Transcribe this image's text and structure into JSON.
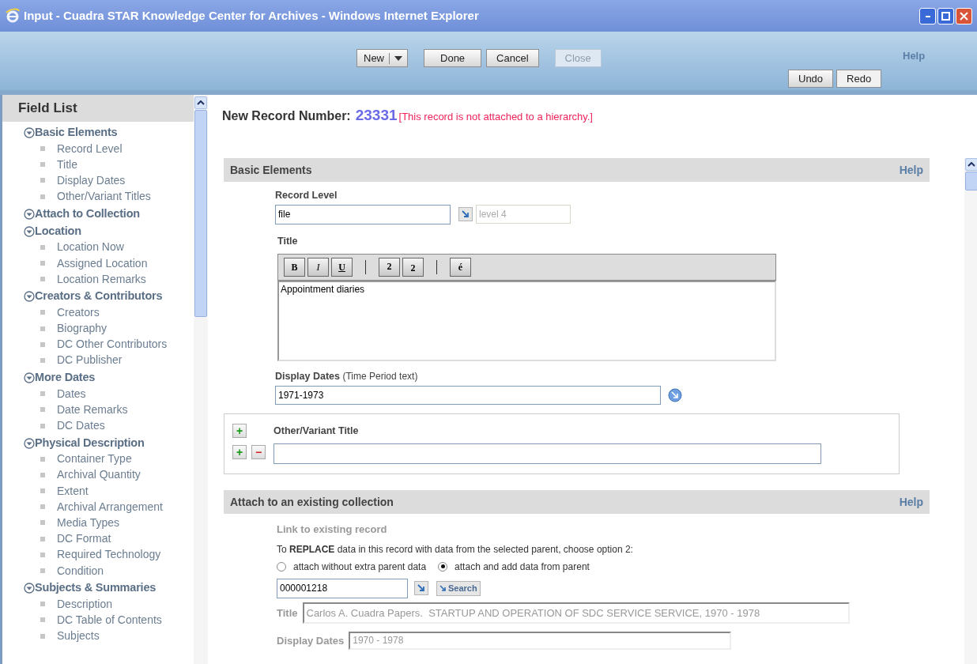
{
  "window": {
    "title": "Input - Cuadra STAR Knowledge Center for Archives - Windows Internet Explorer"
  },
  "toolbar": {
    "buttons": [
      {
        "label": "New",
        "kind": "split",
        "disabled": false
      },
      {
        "label": "Done",
        "kind": "plain",
        "disabled": false
      },
      {
        "label": "Cancel",
        "kind": "plain",
        "disabled": false
      },
      {
        "label": "Close",
        "kind": "plain",
        "disabled": true
      }
    ],
    "help": "Help",
    "history_buttons": [
      {
        "label": "Undo",
        "disabled": false
      },
      {
        "label": "Redo",
        "disabled": false
      }
    ]
  },
  "sidebar": {
    "title": "Field List",
    "groups": [
      {
        "label": "Basic Elements",
        "expanded": true,
        "children": [
          {
            "label": "Record Level"
          },
          {
            "label": "Title"
          },
          {
            "label": "Display Dates"
          },
          {
            "label": "Other/Variant Titles"
          }
        ]
      },
      {
        "label": "Attach to Collection",
        "expanded": true
      },
      {
        "label": "Location",
        "expanded": true,
        "children": [
          {
            "label": "Location Now"
          },
          {
            "label": "Assigned Location"
          },
          {
            "label": "Location Remarks"
          }
        ]
      },
      {
        "label": "Creators & Contributors",
        "expanded": true,
        "children": [
          {
            "label": "Creators"
          },
          {
            "label": "Biography"
          },
          {
            "label": "DC Other Contributors"
          },
          {
            "label": "DC Publisher"
          }
        ]
      },
      {
        "label": "More Dates",
        "expanded": true,
        "children": [
          {
            "label": "Dates"
          },
          {
            "label": "Date Remarks"
          },
          {
            "label": "DC Dates"
          }
        ]
      },
      {
        "label": "Physical Description",
        "expanded": true,
        "children": [
          {
            "label": "Container Type"
          },
          {
            "label": "Archival Quantity"
          },
          {
            "label": "Extent"
          },
          {
            "label": "Archival Arrangement"
          },
          {
            "label": "Media Types"
          },
          {
            "label": "DC Format"
          },
          {
            "label": "Required Technology"
          },
          {
            "label": "Condition"
          }
        ]
      },
      {
        "label": "Subjects & Summaries",
        "expanded": true,
        "children": [
          {
            "label": "Description"
          },
          {
            "label": "DC Table of Contents"
          },
          {
            "label": "Subjects"
          }
        ]
      }
    ]
  },
  "record": {
    "label": "New Record Number:",
    "number": "23331",
    "notice": "[This record is not attached to a hierarchy.]"
  },
  "basic_elements": {
    "title": "Basic Elements",
    "help": "Help",
    "record_level": {
      "label": "Record Level",
      "value": "file",
      "level_value": "level 4"
    },
    "title_field": {
      "label": "Title",
      "format_buttons": [
        {
          "label": "B",
          "kind": "bold"
        },
        {
          "label": "I",
          "kind": "italic"
        },
        {
          "label": "U",
          "kind": "underline"
        },
        {
          "label": "2",
          "kind": "sup"
        },
        {
          "label": "2",
          "kind": "sub"
        },
        {
          "label": "é",
          "kind": "char"
        }
      ],
      "value": "Appointment diaries"
    },
    "display_dates": {
      "label": "Display Dates",
      "hint": "(Time Period text)",
      "value": "1971-1973"
    },
    "other_title": {
      "label": "Other/Variant Title",
      "add": "+",
      "remove": "−"
    }
  },
  "attach": {
    "title": "Attach to an existing collection",
    "help": "Help",
    "link_label": "Link to existing record",
    "instruction": "To **REPLACE** data in this record with data from the selected parent, choose option 2:",
    "options": [
      {
        "label": "attach without extra parent data",
        "selected": false
      },
      {
        "label": "attach and add data from parent",
        "selected": true
      }
    ],
    "record_id": "000001218",
    "search": "Search",
    "parent_title": {
      "label": "Title",
      "value": "Carlos A. Cuadra Papers.  STARTUP AND OPERATION OF SDC SERVICE SERVICE, 1970 - 1978"
    },
    "parent_dates": {
      "label": "Display Dates",
      "value": "1970 - 1978"
    }
  }
}
